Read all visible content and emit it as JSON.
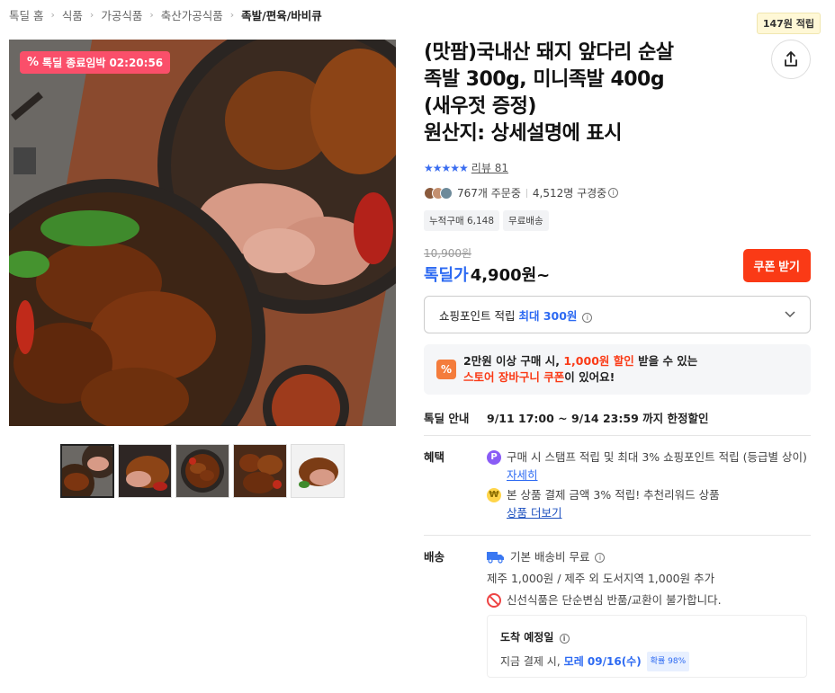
{
  "breadcrumb": [
    "톡딜 홈",
    "식품",
    "가공식품",
    "축산가공식품",
    "족발/편육/바비큐"
  ],
  "points_badge": "147원 적립",
  "timer": {
    "label": "톡딜 종료임박",
    "time": "02:20:56"
  },
  "product": {
    "title_lines": [
      "(맛팜)국내산 돼지 앞다리 순살",
      "족발 300g, 미니족발 400g",
      "(새우젓 증정)",
      "원산지: 상세설명에 표시"
    ],
    "review_label": "리뷰 81",
    "orders": "767개 주문중",
    "viewers": "4,512명 구경중",
    "tags": [
      "누적구매 6,148",
      "무료배송"
    ],
    "original_price": "10,900원",
    "sale_label": "톡딜가",
    "sale_price": "4,900원~",
    "coupon_button": "쿠폰 받기"
  },
  "point_select": {
    "label": "쇼핑포인트 적립",
    "highlight": "최대 300원"
  },
  "cart_coupon": {
    "line1_pre": "2만원 이상 구매 시, ",
    "line1_red": "1,000원 할인",
    "line1_post": " 받을 수 있는",
    "line2_red": "스토어 장바구니 쿠폰",
    "line2_post": "이 있어요!"
  },
  "deal": {
    "label": "톡딜 안내",
    "value": "9/11 17:00 ~ 9/14 23:59 까지 한정할인"
  },
  "benefit": {
    "label": "혜택",
    "item1_text": "구매 시 스탬프 적립 및 최대 3% 쇼핑포인트 적립 (등급별 상이)",
    "item1_link": "자세히",
    "item2_text": "본 상품 결제 금액 3% 적립! 추천리워드 상품",
    "item2_link": "상품 더보기"
  },
  "delivery": {
    "label": "배송",
    "line1": "기본 배송비 무료",
    "line2": "제주 1,000원 / 제주 외 도서지역 1,000원 추가",
    "line3": "신선식품은 단순변심 반품/교환이 불가합니다."
  },
  "arrival": {
    "title": "도착 예정일",
    "pre": "지금 결제 시,",
    "date": "모레 09/16(수)",
    "prob": "확률 98%"
  },
  "colors": {
    "accent_blue": "#2d6af2",
    "coupon_red": "#fa3a16",
    "timer_pink": "#fa4f6a"
  }
}
